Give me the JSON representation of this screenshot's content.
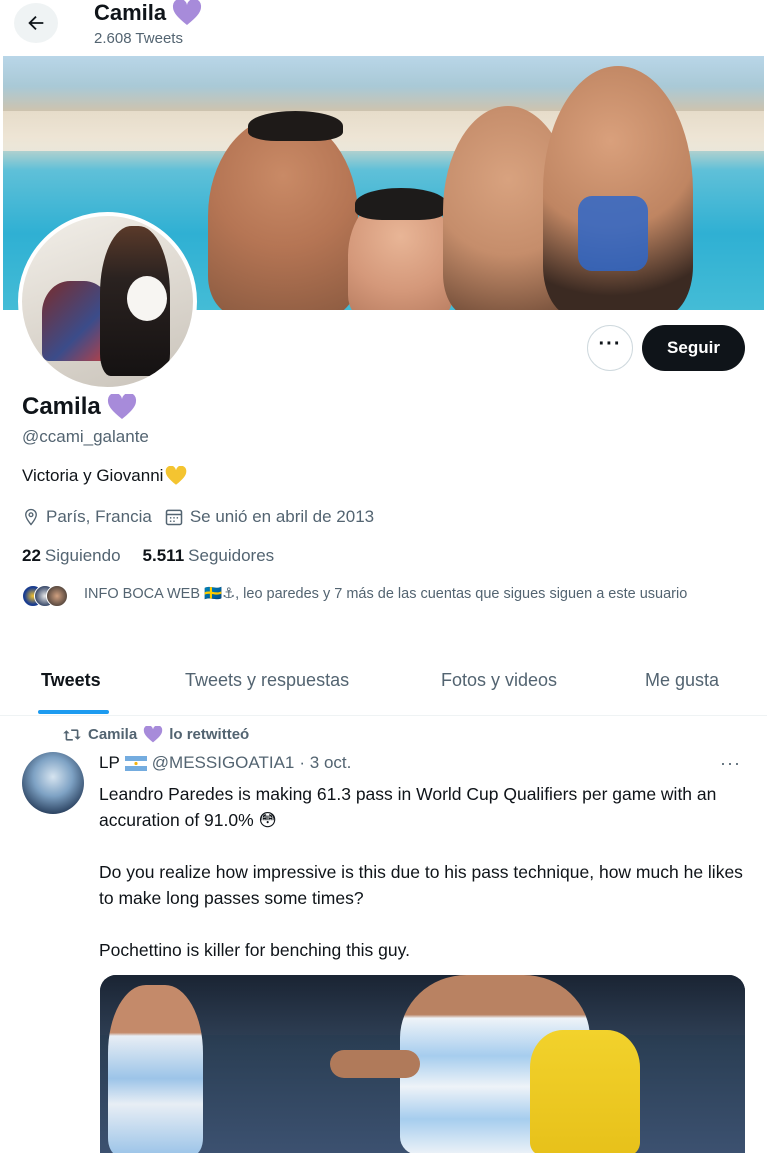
{
  "header": {
    "name": "Camila",
    "tweet_count": "2.608 Tweets"
  },
  "profile": {
    "name": "Camila",
    "handle": "@ccami_galante",
    "bio": "Victoria y Giovanni",
    "location": "París, Francia",
    "joined": "Se unió en abril de 2013",
    "following_count": "22",
    "following_label": "Siguiendo",
    "followers_count": "5.511",
    "followers_label": "Seguidores",
    "followers_you_know": "INFO BOCA WEB 🇸🇪⚓, leo paredes y 7 más de las cuentas que sigues siguen a este usuario",
    "follow_label": "Seguir",
    "more_label": "···"
  },
  "tabs": [
    {
      "label": "Tweets"
    },
    {
      "label": "Tweets y respuestas"
    },
    {
      "label": "Fotos y videos"
    },
    {
      "label": "Me gusta"
    }
  ],
  "tweet": {
    "retweeted_by": "Camila",
    "retweet_label": "lo retwitteó",
    "author_name": "LP",
    "author_handle": "@MESSIGOATIA1",
    "date": "· 3 oct.",
    "more_label": "···",
    "paragraphs": [
      "Leandro Paredes is making 61.3 pass in World Cup Qualifiers per game with an accuration of 91.0% 😳",
      "Do you realize how impressive is this due to his pass technique, how much he likes to make long passes some times?",
      "Pochettino is killer for benching this guy."
    ]
  },
  "colors": {
    "accent": "#1d9bf0",
    "heart": "#a78bda",
    "follow_button": "#0f1419",
    "secondary_text": "#536471"
  },
  "icons": {
    "back": "arrow-left-icon",
    "location": "location-pin-icon",
    "calendar": "calendar-icon",
    "retweet": "retweet-icon"
  }
}
